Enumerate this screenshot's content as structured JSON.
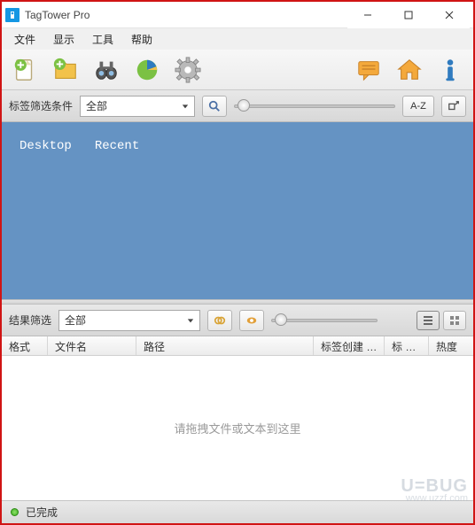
{
  "title": "TagTower Pro",
  "menu": {
    "file": "文件",
    "view": "显示",
    "tools": "工具",
    "help": "帮助"
  },
  "toolbar": {
    "new_file": "new-file",
    "new_folder": "new-folder",
    "binoculars": "search",
    "chart": "chart",
    "settings": "settings",
    "chat": "chat",
    "home": "home",
    "info": "info"
  },
  "filter1": {
    "label": "标签筛选条件",
    "combo_value": "全部",
    "sort_btn": "A-Z",
    "expand_btn": "□↗"
  },
  "tags": {
    "items": [
      "Desktop",
      "Recent"
    ]
  },
  "filter2": {
    "label": "结果筛选",
    "combo_value": "全部"
  },
  "columns": {
    "c0": "格式",
    "c1": "文件名",
    "c2": "路径",
    "c3": "标签创建 …",
    "c4": "标 …",
    "c5": "热度"
  },
  "body": {
    "placeholder": "请拖拽文件或文本到这里"
  },
  "status": {
    "text": "已完成"
  },
  "watermark": {
    "main": "U=BUG",
    "sub": "www.uzzf.com"
  }
}
